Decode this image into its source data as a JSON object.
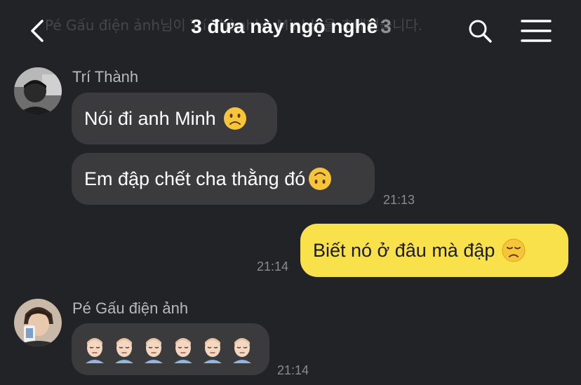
{
  "header": {
    "ghost_text": "Pé Gấu điện ảnh님이 Trí Thành님, Minh님을 초대했습니다.",
    "title": "3 đứa này ngộ nghê",
    "member_count": "3",
    "icons": {
      "back": "chevron-left-icon",
      "search": "search-icon",
      "menu": "hamburger-menu-icon"
    }
  },
  "messages": [
    {
      "sender": "Trí Thành",
      "bubbles": [
        {
          "text": "Nói đi anh Minh",
          "emoji": "slightly-frowning-face"
        },
        {
          "text": "Em đập chết cha thằng đó",
          "emoji": "upside-down-face"
        }
      ],
      "time": "21:13"
    },
    {
      "sender": "me",
      "bubbles": [
        {
          "text": "Biết nó ở đâu mà đập",
          "emoji": "disappointed-face"
        }
      ],
      "time": "21:14"
    },
    {
      "sender": "Pé Gấu điện ảnh",
      "bubbles": [
        {
          "text": "",
          "emoji": "sleeping-face x6"
        }
      ],
      "time": "21:14"
    }
  ],
  "colors": {
    "background": "#222326",
    "incoming_bubble": "#3b3b3e",
    "outgoing_bubble": "#f9e14b"
  }
}
